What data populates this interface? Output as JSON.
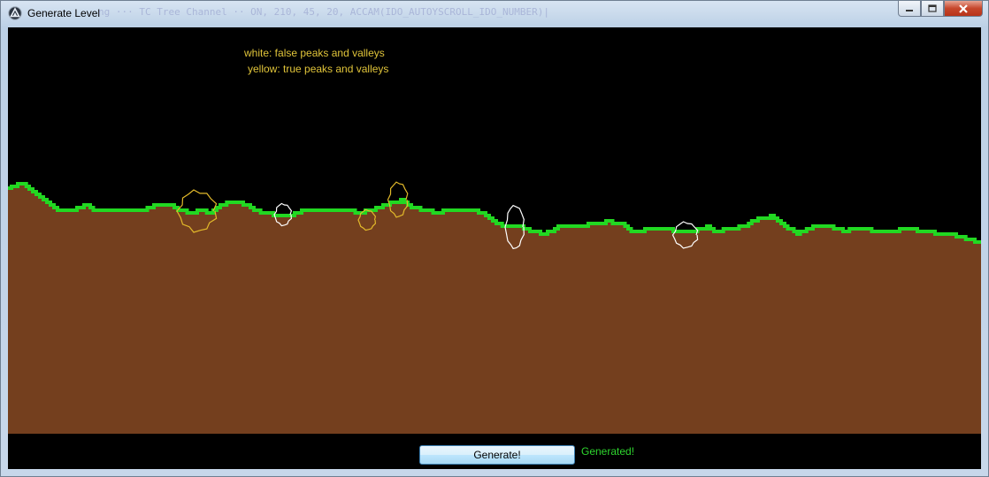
{
  "window": {
    "title": "Generate Level",
    "background_ghost_text": "ng    ··· TC Tree Channel   ··      ON, 210, 45, 20, ACCAM(IDO_AUTOYSCROLL_IDO_NUMBER)|",
    "minimize_icon": "minimize-icon",
    "maximize_icon": "maximize-icon",
    "close_icon": "close-icon"
  },
  "legend": {
    "white_text": "white: false peaks and valleys",
    "yellow_text": "yellow: true peaks and valleys"
  },
  "colors": {
    "sky": "#000000",
    "ground": "#743f1e",
    "grass": "#22d822",
    "true_marker": "#e2b92a",
    "false_marker": "#ffffff",
    "status_text": "#2ed52e"
  },
  "generate_button": {
    "label": "Generate!"
  },
  "status": {
    "text": "Generated!"
  }
}
